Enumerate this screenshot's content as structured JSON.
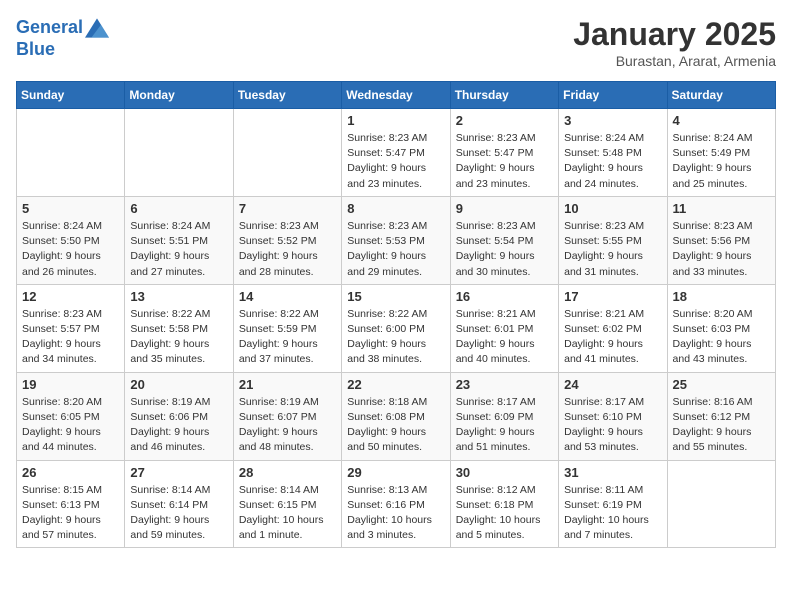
{
  "header": {
    "logo_line1": "General",
    "logo_line2": "Blue",
    "month": "January 2025",
    "location": "Burastan, Ararat, Armenia"
  },
  "weekdays": [
    "Sunday",
    "Monday",
    "Tuesday",
    "Wednesday",
    "Thursday",
    "Friday",
    "Saturday"
  ],
  "weeks": [
    [
      {
        "day": "",
        "info": ""
      },
      {
        "day": "",
        "info": ""
      },
      {
        "day": "",
        "info": ""
      },
      {
        "day": "1",
        "info": "Sunrise: 8:23 AM\nSunset: 5:47 PM\nDaylight: 9 hours\nand 23 minutes."
      },
      {
        "day": "2",
        "info": "Sunrise: 8:23 AM\nSunset: 5:47 PM\nDaylight: 9 hours\nand 23 minutes."
      },
      {
        "day": "3",
        "info": "Sunrise: 8:24 AM\nSunset: 5:48 PM\nDaylight: 9 hours\nand 24 minutes."
      },
      {
        "day": "4",
        "info": "Sunrise: 8:24 AM\nSunset: 5:49 PM\nDaylight: 9 hours\nand 25 minutes."
      }
    ],
    [
      {
        "day": "5",
        "info": "Sunrise: 8:24 AM\nSunset: 5:50 PM\nDaylight: 9 hours\nand 26 minutes."
      },
      {
        "day": "6",
        "info": "Sunrise: 8:24 AM\nSunset: 5:51 PM\nDaylight: 9 hours\nand 27 minutes."
      },
      {
        "day": "7",
        "info": "Sunrise: 8:23 AM\nSunset: 5:52 PM\nDaylight: 9 hours\nand 28 minutes."
      },
      {
        "day": "8",
        "info": "Sunrise: 8:23 AM\nSunset: 5:53 PM\nDaylight: 9 hours\nand 29 minutes."
      },
      {
        "day": "9",
        "info": "Sunrise: 8:23 AM\nSunset: 5:54 PM\nDaylight: 9 hours\nand 30 minutes."
      },
      {
        "day": "10",
        "info": "Sunrise: 8:23 AM\nSunset: 5:55 PM\nDaylight: 9 hours\nand 31 minutes."
      },
      {
        "day": "11",
        "info": "Sunrise: 8:23 AM\nSunset: 5:56 PM\nDaylight: 9 hours\nand 33 minutes."
      }
    ],
    [
      {
        "day": "12",
        "info": "Sunrise: 8:23 AM\nSunset: 5:57 PM\nDaylight: 9 hours\nand 34 minutes."
      },
      {
        "day": "13",
        "info": "Sunrise: 8:22 AM\nSunset: 5:58 PM\nDaylight: 9 hours\nand 35 minutes."
      },
      {
        "day": "14",
        "info": "Sunrise: 8:22 AM\nSunset: 5:59 PM\nDaylight: 9 hours\nand 37 minutes."
      },
      {
        "day": "15",
        "info": "Sunrise: 8:22 AM\nSunset: 6:00 PM\nDaylight: 9 hours\nand 38 minutes."
      },
      {
        "day": "16",
        "info": "Sunrise: 8:21 AM\nSunset: 6:01 PM\nDaylight: 9 hours\nand 40 minutes."
      },
      {
        "day": "17",
        "info": "Sunrise: 8:21 AM\nSunset: 6:02 PM\nDaylight: 9 hours\nand 41 minutes."
      },
      {
        "day": "18",
        "info": "Sunrise: 8:20 AM\nSunset: 6:03 PM\nDaylight: 9 hours\nand 43 minutes."
      }
    ],
    [
      {
        "day": "19",
        "info": "Sunrise: 8:20 AM\nSunset: 6:05 PM\nDaylight: 9 hours\nand 44 minutes."
      },
      {
        "day": "20",
        "info": "Sunrise: 8:19 AM\nSunset: 6:06 PM\nDaylight: 9 hours\nand 46 minutes."
      },
      {
        "day": "21",
        "info": "Sunrise: 8:19 AM\nSunset: 6:07 PM\nDaylight: 9 hours\nand 48 minutes."
      },
      {
        "day": "22",
        "info": "Sunrise: 8:18 AM\nSunset: 6:08 PM\nDaylight: 9 hours\nand 50 minutes."
      },
      {
        "day": "23",
        "info": "Sunrise: 8:17 AM\nSunset: 6:09 PM\nDaylight: 9 hours\nand 51 minutes."
      },
      {
        "day": "24",
        "info": "Sunrise: 8:17 AM\nSunset: 6:10 PM\nDaylight: 9 hours\nand 53 minutes."
      },
      {
        "day": "25",
        "info": "Sunrise: 8:16 AM\nSunset: 6:12 PM\nDaylight: 9 hours\nand 55 minutes."
      }
    ],
    [
      {
        "day": "26",
        "info": "Sunrise: 8:15 AM\nSunset: 6:13 PM\nDaylight: 9 hours\nand 57 minutes."
      },
      {
        "day": "27",
        "info": "Sunrise: 8:14 AM\nSunset: 6:14 PM\nDaylight: 9 hours\nand 59 minutes."
      },
      {
        "day": "28",
        "info": "Sunrise: 8:14 AM\nSunset: 6:15 PM\nDaylight: 10 hours\nand 1 minute."
      },
      {
        "day": "29",
        "info": "Sunrise: 8:13 AM\nSunset: 6:16 PM\nDaylight: 10 hours\nand 3 minutes."
      },
      {
        "day": "30",
        "info": "Sunrise: 8:12 AM\nSunset: 6:18 PM\nDaylight: 10 hours\nand 5 minutes."
      },
      {
        "day": "31",
        "info": "Sunrise: 8:11 AM\nSunset: 6:19 PM\nDaylight: 10 hours\nand 7 minutes."
      },
      {
        "day": "",
        "info": ""
      }
    ]
  ]
}
